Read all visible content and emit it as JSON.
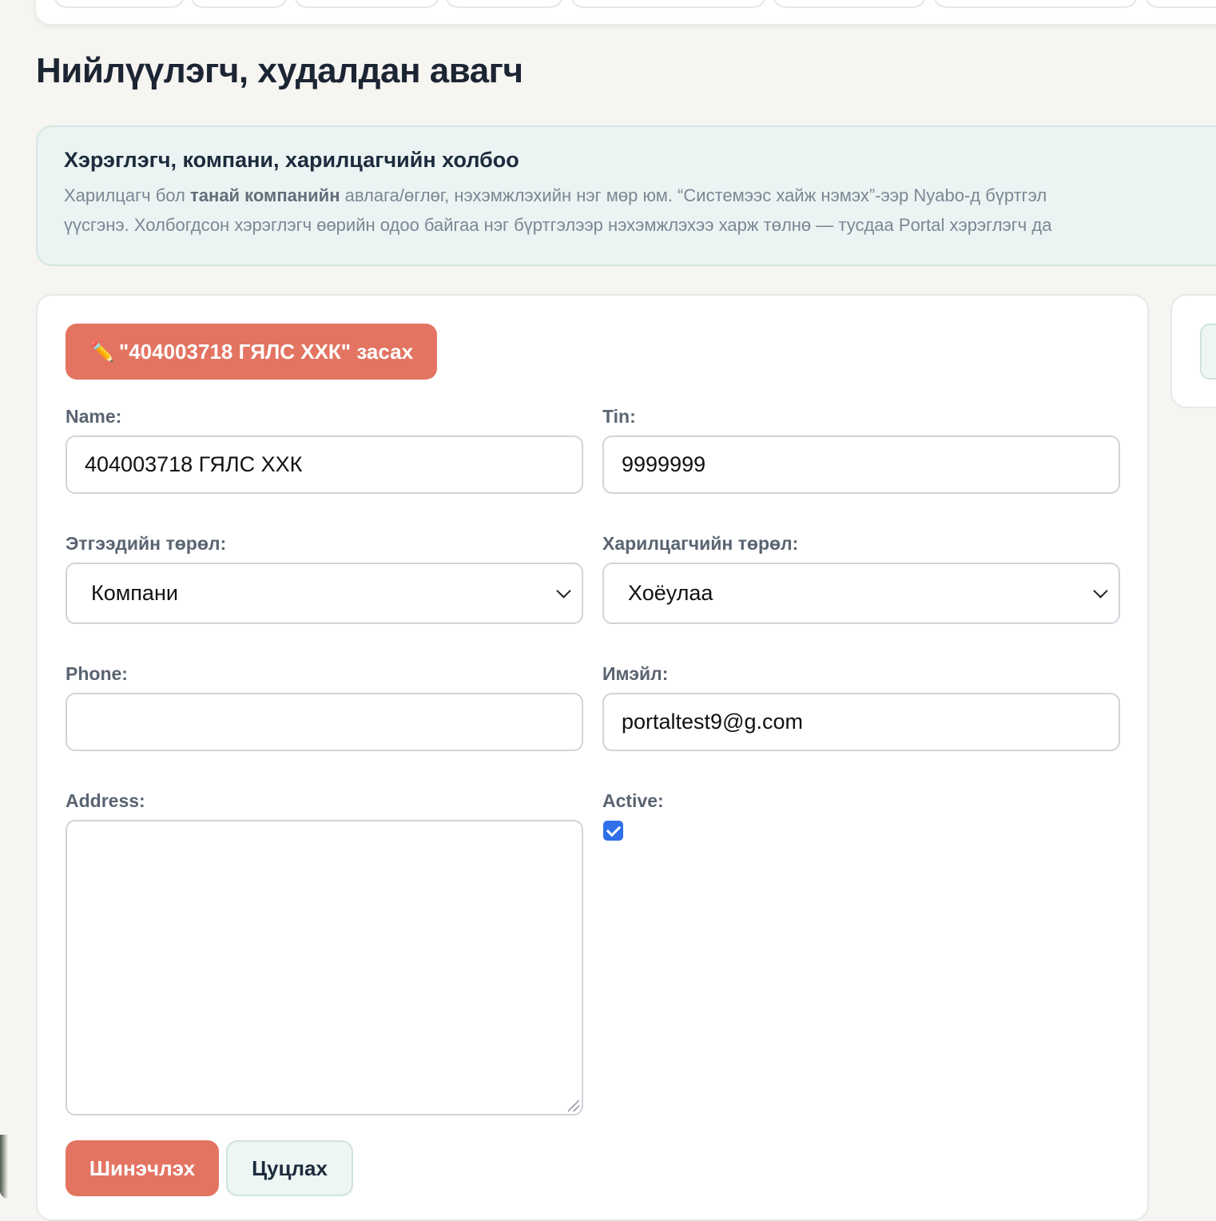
{
  "page": {
    "title": "Нийлүүлэгч, худалдан авагч"
  },
  "info": {
    "title": "Хэрэглэгч, компани, харилцагчийн холбоо",
    "line1_part1": "Харилцагч бол ",
    "line1_bold": "танай компанийн",
    "line1_part2": " авлага/өглөг, нэхэмжлэхийн нэг мөр юм. “Системээс хайж нэмэх”-ээр Nyabo-д бүртгэл",
    "line2": "үүсгэнэ. Холбогдсон хэрэглэгч өөрийн одоо байгаа нэг бүртгэлээр нэхэмжлэхээ харж төлнө — тусдаа Portal хэрэглэгч да"
  },
  "form": {
    "edit_banner": "\"404003718 ГЯЛС ХХК\" засах",
    "edit_icon": "pencil-icon",
    "name_label": "Name:",
    "name_value": "404003718 ГЯЛС ХХК",
    "tin_label": "Tin:",
    "tin_value": "9999999",
    "entity_type_label": "Этгээдийн төрөл:",
    "entity_type_value": "Компани",
    "partner_type_label": "Харилцагчийн төрөл:",
    "partner_type_value": "Хоёулаа",
    "phone_label": "Phone:",
    "phone_value": "",
    "email_label": "Имэйл:",
    "email_value": "portaltest9@g.com",
    "address_label": "Address:",
    "address_value": "",
    "active_label": "Active:",
    "active_checked": true,
    "update_button": "Шинэчлэх",
    "cancel_button": "Цуцлах"
  },
  "colors": {
    "accent": "#e37462",
    "info_bg": "#ebf4f2",
    "checkbox": "#2f6fe8"
  }
}
